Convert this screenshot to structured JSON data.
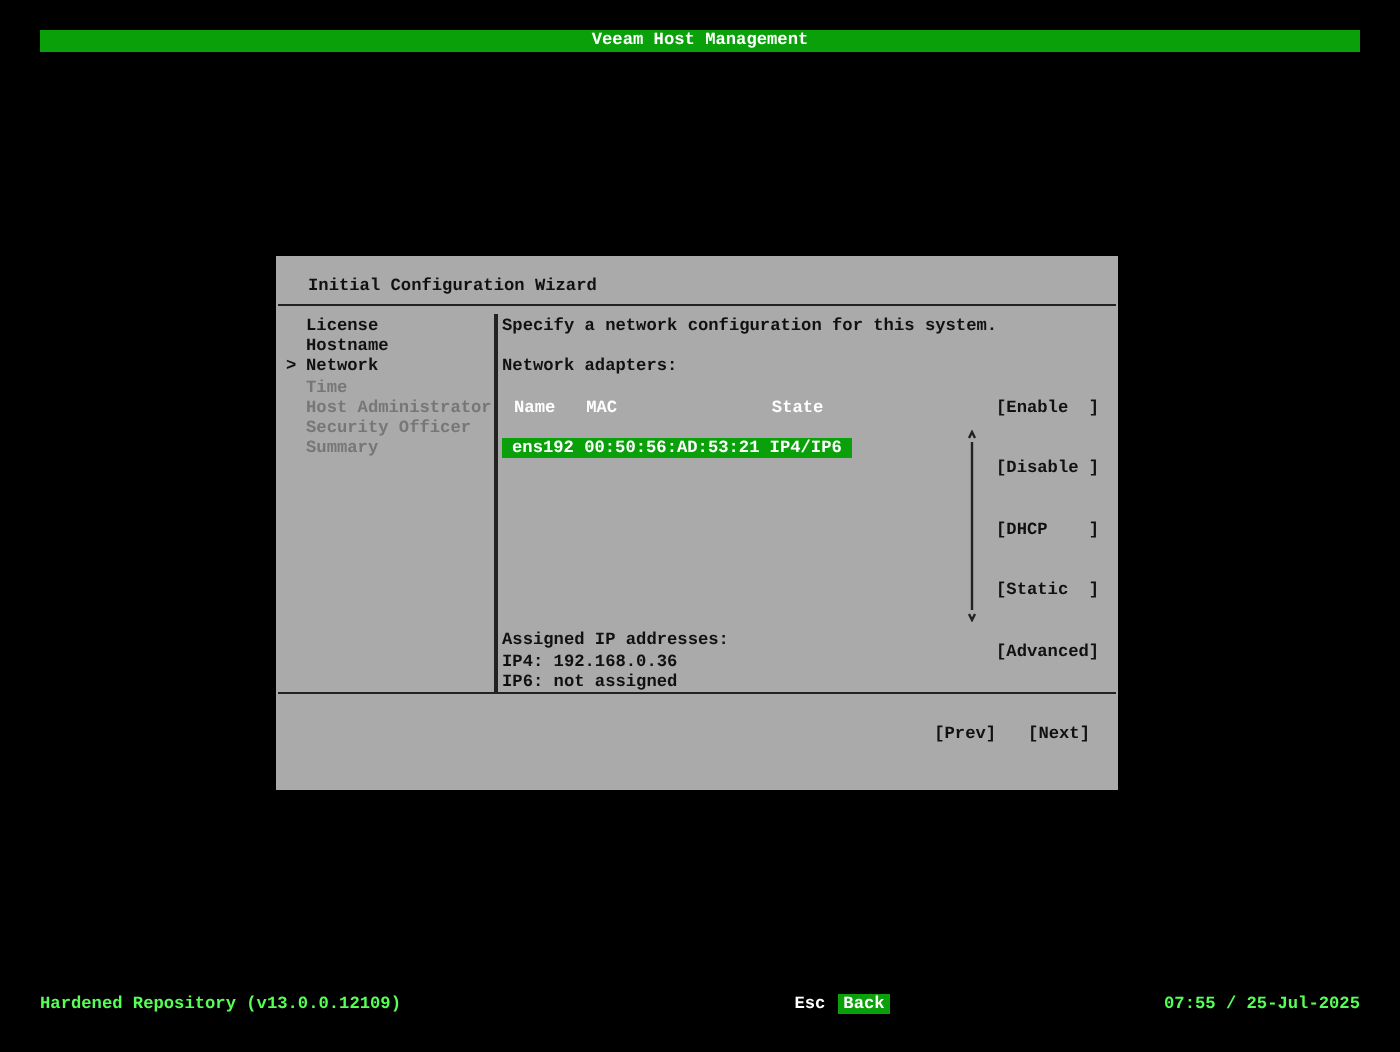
{
  "header": {
    "title": "Veeam Host Management"
  },
  "wizard": {
    "title": "Initial Configuration Wizard",
    "steps": [
      {
        "label": "License",
        "selected": false,
        "disabled": false
      },
      {
        "label": "Hostname",
        "selected": false,
        "disabled": false
      },
      {
        "label": "Network",
        "selected": true,
        "disabled": false
      },
      {
        "label": "Time",
        "selected": false,
        "disabled": true
      },
      {
        "label": "Host Administrator",
        "selected": false,
        "disabled": true
      },
      {
        "label": "Security Officer",
        "selected": false,
        "disabled": true
      },
      {
        "label": "Summary",
        "selected": false,
        "disabled": true
      }
    ],
    "step_marker": ">",
    "intro": "Specify a network configuration for this system.",
    "adapters_label": "Network adapters:",
    "columns": [
      "Name",
      "MAC",
      "State"
    ],
    "adapters": [
      {
        "name": "ens192",
        "mac": "00:50:56:AD:53:21",
        "state": "IP4/IP6",
        "selected": true
      }
    ],
    "actions": [
      "[Enable  ]",
      "[Disable ]",
      "[DHCP    ]",
      "[Static  ]",
      "[Advanced]"
    ],
    "assigned": [
      "Assigned IP addresses:",
      "IP4: 192.168.0.36",
      "IP6: not assigned"
    ],
    "nav_buttons": [
      "[Prev]",
      "[Next]"
    ]
  },
  "footer": {
    "product": "Hardened Repository (v13.0.0.12109)",
    "key": "Esc",
    "key_action": "Back",
    "datetime": "07:55 / 25-Jul-2025"
  }
}
